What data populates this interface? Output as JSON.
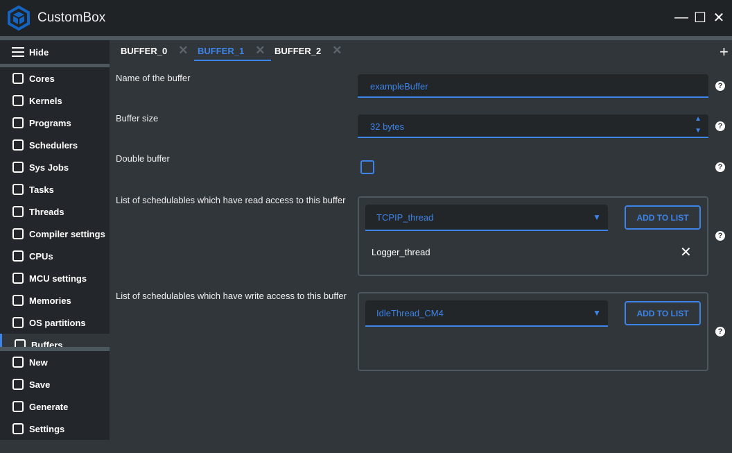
{
  "app": {
    "title": "CustomBox",
    "accent": "#3d84e8"
  },
  "window": {
    "minimize": "—",
    "maximize": "☐",
    "close": "✕"
  },
  "sidebar": {
    "hide_label": "Hide",
    "items": [
      {
        "label": "Cores",
        "icon": "chip-icon"
      },
      {
        "label": "Kernels",
        "icon": "folder-icon"
      },
      {
        "label": "Programs",
        "icon": "bookmark-icon"
      },
      {
        "label": "Schedulers",
        "icon": "clock-icon"
      },
      {
        "label": "Sys Jobs",
        "icon": "briefcase-icon"
      },
      {
        "label": "Tasks",
        "icon": "check-circle-icon"
      },
      {
        "label": "Threads",
        "icon": "calendar-icon"
      },
      {
        "label": "Compiler settings",
        "icon": "checklist-icon"
      },
      {
        "label": "CPUs",
        "icon": "chip-icon"
      },
      {
        "label": "MCU settings",
        "icon": "dashboard-icon"
      },
      {
        "label": "Memories",
        "icon": "memory-icon"
      },
      {
        "label": "OS partitions",
        "icon": "list-icon"
      },
      {
        "label": "Buffers",
        "icon": "archive-icon",
        "active": true
      }
    ],
    "actions": [
      {
        "label": "New",
        "icon": "pencil-icon"
      },
      {
        "label": "Save",
        "icon": "save-icon"
      },
      {
        "label": "Generate",
        "icon": "refresh-icon"
      },
      {
        "label": "Settings",
        "icon": "gear-icon"
      }
    ]
  },
  "tabs": [
    {
      "label": "BUFFER_0"
    },
    {
      "label": "BUFFER_1",
      "active": true
    },
    {
      "label": "BUFFER_2"
    }
  ],
  "tab_close": "✕",
  "add_tab": "+",
  "form": {
    "name_label": "Name of the buffer",
    "name_value": "exampleBuffer",
    "size_label": "Buffer size",
    "size_value": "32 bytes",
    "double_label": "Double buffer",
    "double_checked": false,
    "read_label": "List of schedulables which have read access to this buffer",
    "read_select": "TCPIP_thread",
    "read_items": [
      "Logger_thread"
    ],
    "write_label": "List of schedulables which have write access to this buffer",
    "write_select": "IdleThread_CM4",
    "add_label": "ADD TO LIST",
    "help": "?",
    "remove": "✕"
  }
}
